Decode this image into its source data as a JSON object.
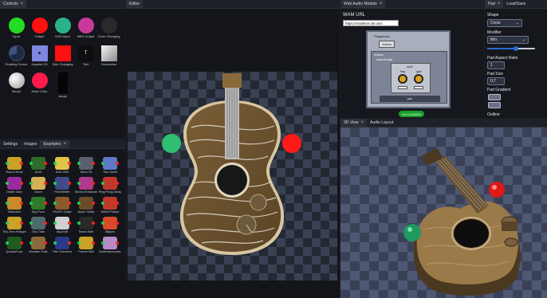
{
  "controls": {
    "tab": "Controls",
    "items": [
      {
        "label": "Input",
        "color": "#22dd22",
        "shape": "circle"
      },
      {
        "label": "Output",
        "color": "#ff1010",
        "shape": "circle"
      },
      {
        "label": "MIDI Input",
        "color": "#2ab38a",
        "shape": "circle"
      },
      {
        "label": "MIDI Output",
        "color": "#c83a9a",
        "shape": "circle"
      },
      {
        "label": "Color Changing",
        "color": "#2a2a2a",
        "shape": "circle"
      },
      {
        "label": "Rotating Cursor",
        "color": "#1d2a44",
        "shape": "circle"
      },
      {
        "label": "Joystick 2D",
        "color": "#7f87e0",
        "shape": "square"
      },
      {
        "label": "Size Changing",
        "color": "#ff1010",
        "shape": "square"
      },
      {
        "label": "Text",
        "color": "#0e0e0e",
        "shape": "text"
      },
      {
        "label": "Decoration",
        "color": "#d9d9d9",
        "shape": "square"
      },
      {
        "label": "Morph",
        "color": "#d8d8d8",
        "shape": "circle"
      },
      {
        "label": "Hash Color",
        "color": "#ff1a4a",
        "shape": "circle"
      },
      {
        "label": "Jauge",
        "color": "#050505",
        "shape": "square"
      }
    ]
  },
  "library": {
    "tabs": [
      "Settings",
      "Images",
      "Examples"
    ],
    "examples": [
      {
        "label": "Round Knob",
        "color": "#c9a227"
      },
      {
        "label": "Knob",
        "color": "#2f6b2a"
      },
      {
        "label": "Kool Verb",
        "color": "#e2c34a"
      },
      {
        "label": "Micro Sil",
        "color": "#5a5f6d"
      },
      {
        "label": "Tiny Synth",
        "color": "#5c7ac9"
      },
      {
        "label": "Death Gate",
        "color": "#9a2aa0"
      },
      {
        "label": "Drum",
        "color": "#d8b054"
      },
      {
        "label": "PitchShifter",
        "color": "#3e4c8a"
      },
      {
        "label": "Stereo Enhancer",
        "color": "#b03a8a"
      },
      {
        "label": "Ping Pong Delay",
        "color": "#c0392b"
      },
      {
        "label": "Distortion",
        "color": "#c98a2a"
      },
      {
        "label": "Kpp Fuzz",
        "color": "#2f7a2a"
      },
      {
        "label": "FAUST Guitar",
        "color": "#8a5a2a"
      },
      {
        "label": "Nylon Guitar",
        "color": "#6a4b2a"
      },
      {
        "label": "Weird Phaser",
        "color": "#c0392b"
      },
      {
        "label": "Tiny Zero Flanger",
        "color": "#c9a227"
      },
      {
        "label": "Osc Tube",
        "color": "#4f6a6a"
      },
      {
        "label": "Big Muff",
        "color": "#cfcfcf"
      },
      {
        "label": "Smart Wah",
        "color": "#2a2a2a"
      },
      {
        "label": "Blipper",
        "color": "#d94a2a"
      },
      {
        "label": "QuadraFuzz",
        "color": "#1f5a1f"
      },
      {
        "label": "Wooden Flute",
        "color": "#8a6a3a"
      },
      {
        "label": "Tibe Overdrive",
        "color": "#2a3a8a"
      },
      {
        "label": "French Bell",
        "color": "#c9a227"
      },
      {
        "label": "DualHarmonizer",
        "color": "#b88ac9"
      }
    ]
  },
  "editor": {
    "tab": "Editor"
  },
  "wam": {
    "tab": "Web Audio Module",
    "url_label": "WAM URL",
    "url_value": "https://mainline.i3s.unic",
    "poly_title": "Polyphonic",
    "voices_label": "Voices",
    "voices_sub": "nylonGuitar",
    "voices_box": "Voices",
    "midi_label": "midi",
    "knob1": "freq",
    "knob2": "gain",
    "gate_label": "gate",
    "loaded": "GUI LOADED"
  },
  "view3d": {
    "tabs": [
      "3D View",
      "Audio Layout"
    ]
  },
  "pad": {
    "tabs": [
      "Pad",
      "Load/Save"
    ],
    "shape_label": "Shape",
    "shape_value": "Circle",
    "modifier_label": "Modifier",
    "modifier_value": "thin",
    "aspect_label": "Pad Aspect Ratio",
    "aspect_value": "1",
    "size_label": "Pad Size",
    "size_value": "0,7",
    "gradient_label": "Pad Gradient",
    "outline_label": "Outline",
    "slider_level": 0.6
  },
  "colors": {
    "input_green": "#2fbf71",
    "output_red": "#ff1a1a",
    "wood": "#8a6a3a",
    "accent_blue": "#2a6bd6"
  }
}
